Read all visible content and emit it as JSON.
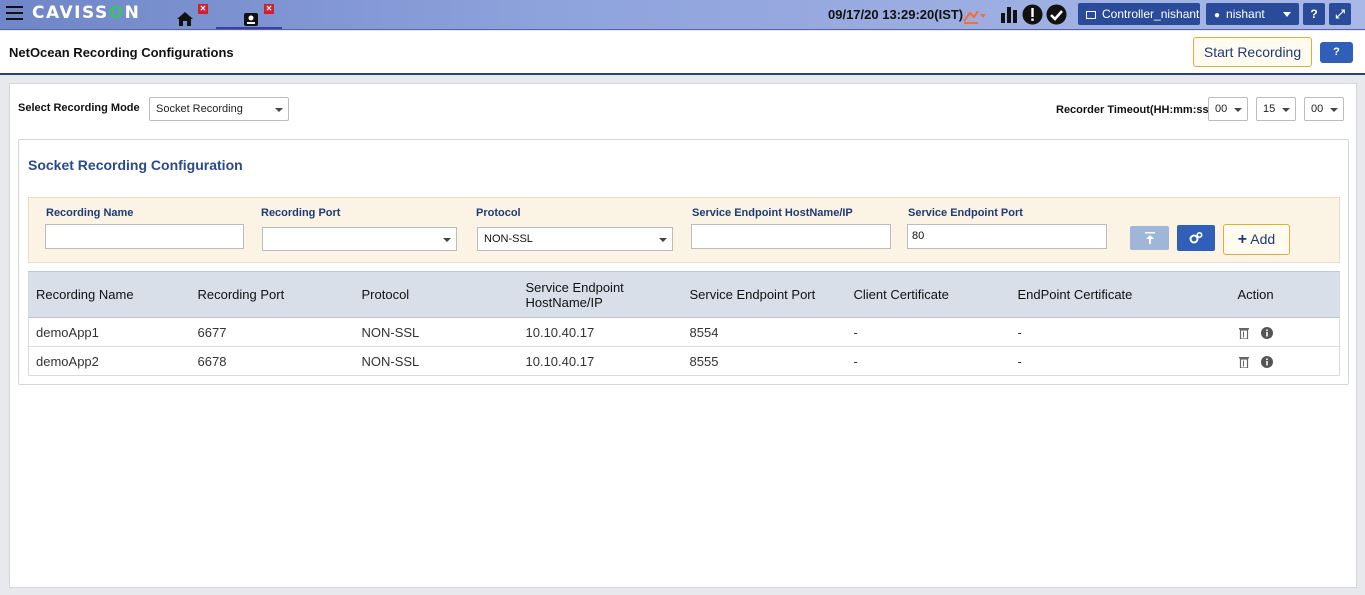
{
  "topbar": {
    "brand_left": "CAVISS",
    "brand_o": "O",
    "brand_right": "N",
    "tab_close": "✕",
    "datetime": "09/17/20 13:29:20(IST)",
    "controller": "Controller_nishant",
    "user": "nishant",
    "help": "?",
    "expand": "⤢"
  },
  "header": {
    "title": "NetOcean Recording Configurations",
    "start_recording": "Start Recording",
    "help": "?"
  },
  "mode": {
    "label": "Select Recording Mode",
    "selected": "Socket Recording"
  },
  "timeout": {
    "label": "Recorder Timeout(HH:mm:ss)",
    "hh": "00",
    "mm": "15",
    "ss": "00"
  },
  "section": {
    "title": "Socket Recording Configuration"
  },
  "form": {
    "recording_name_label": "Recording Name",
    "recording_name_value": "",
    "recording_port_label": "Recording Port",
    "recording_port_value": "",
    "protocol_label": "Protocol",
    "protocol_value": "NON-SSL",
    "host_label": "Service Endpoint HostName/IP",
    "host_value": "",
    "port_label": "Service Endpoint Port",
    "port_value": "80",
    "add_label": "Add"
  },
  "table": {
    "headers": [
      "Recording Name",
      "Recording Port",
      "Protocol",
      "Service Endpoint HostName/IP",
      "Service Endpoint Port",
      "Client Certificate",
      "EndPoint Certificate",
      "Action"
    ],
    "rows": [
      [
        "demoApp1",
        "6677",
        "NON-SSL",
        "10.10.40.17",
        "8554",
        "-",
        "-"
      ],
      [
        "demoApp2",
        "6678",
        "NON-SSL",
        "10.10.40.17",
        "8555",
        "-",
        "-"
      ]
    ]
  },
  "colors": {
    "accent": "#2a4a9a",
    "section_title": "#2a4a8e",
    "form_bg": "#fbf3e3"
  }
}
